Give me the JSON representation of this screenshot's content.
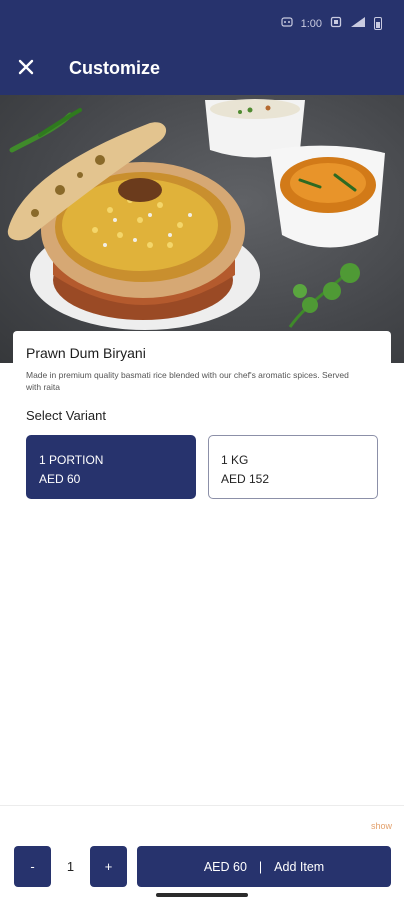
{
  "status_bar": {
    "time_hint": "1:00"
  },
  "header": {
    "title": "Customize"
  },
  "item": {
    "name": "Prawn Dum Biryani",
    "description": "Made in premium quality basmati rice blended with our chef's aromatic spices. Served with raita"
  },
  "variants": {
    "label": "Select Variant",
    "options": [
      {
        "name": "1 PORTION",
        "price": "AED 60",
        "selected": true
      },
      {
        "name": "1 KG",
        "price": "AED 152",
        "selected": false
      }
    ]
  },
  "footer": {
    "show_label": "show",
    "minus_label": "-",
    "plus_label": "+",
    "quantity": "1",
    "add_price": "AED 60",
    "add_separator": "|",
    "add_label": "Add Item"
  },
  "colors": {
    "brand": "#27336d",
    "accent": "#e3a06b"
  }
}
